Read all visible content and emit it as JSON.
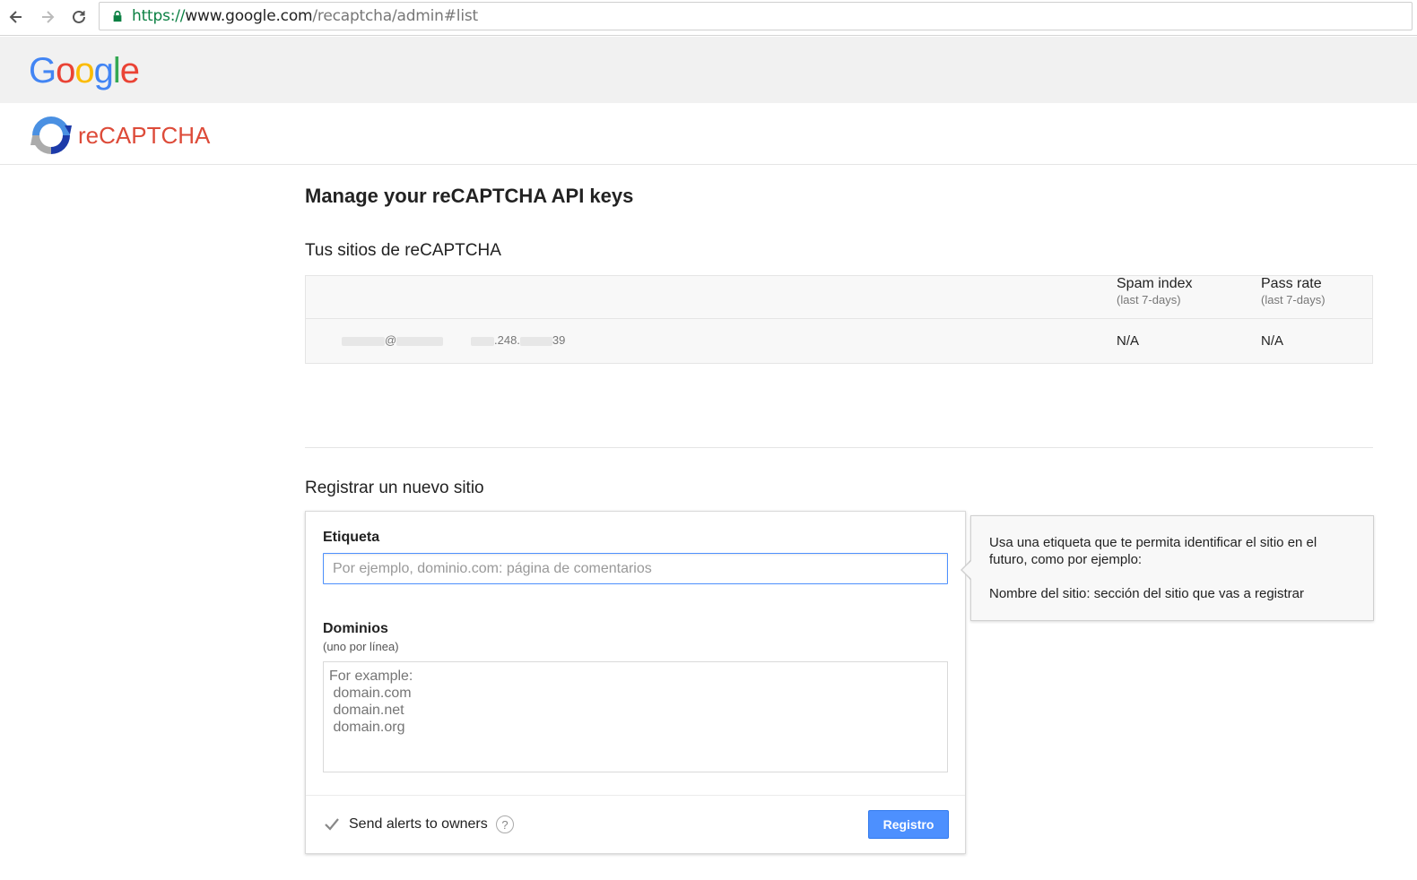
{
  "browser": {
    "url_scheme": "https://",
    "url_host": "www.google.com",
    "url_path": "/recaptcha/admin#list"
  },
  "header": {
    "google_logo": [
      "G",
      "o",
      "o",
      "g",
      "l",
      "e"
    ],
    "product_name": "reCAPTCHA"
  },
  "main": {
    "page_title": "Manage your reCAPTCHA API keys",
    "sites_section_title": "Tus sitios de reCAPTCHA",
    "sites_table": {
      "columns": [
        {
          "title": "Spam index",
          "subtitle": "(last 7-days)"
        },
        {
          "title": "Pass rate",
          "subtitle": "(last 7-days)"
        }
      ],
      "rows": [
        {
          "label_visible": "@",
          "domain_visible_mid": ".248.",
          "domain_visible_end": "39",
          "spam_index": "N/A",
          "pass_rate": "N/A"
        }
      ]
    },
    "register_section_title": "Registrar un nuevo sitio",
    "form": {
      "label_field": {
        "label": "Etiqueta",
        "placeholder": "Por ejemplo, dominio.com: página de comentarios",
        "value": ""
      },
      "domains_field": {
        "label": "Dominios",
        "sublabel": "(uno por línea)",
        "placeholder": "For example:\n domain.com\n domain.net\n domain.org"
      },
      "alerts_checkbox": {
        "label": "Send alerts to owners",
        "checked": true
      },
      "help_icon_text": "?",
      "submit_label": "Registro"
    },
    "tooltip": {
      "line1": "Usa una etiqueta que te permita identificar el sitio en el futuro, como por ejemplo:",
      "line2": "Nombre del sitio: sección del sitio que vas a registrar"
    }
  },
  "colors": {
    "accent_blue": "#4d90fe",
    "recaptcha_red": "#dd4b39",
    "secure_green": "#0b8043"
  }
}
